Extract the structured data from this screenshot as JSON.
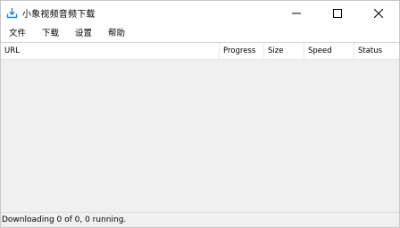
{
  "window": {
    "title": "小象视频音频下载",
    "icon": "download-icon",
    "accent_color": "#1e88e5"
  },
  "window_controls": {
    "minimize_icon": "minimize-icon",
    "maximize_icon": "maximize-icon",
    "close_icon": "close-icon"
  },
  "menu": {
    "items": [
      {
        "label": "文件"
      },
      {
        "label": "下载"
      },
      {
        "label": "设置"
      },
      {
        "label": "帮助"
      }
    ]
  },
  "table": {
    "columns": [
      {
        "label": "URL"
      },
      {
        "label": "Progress"
      },
      {
        "label": "Size"
      },
      {
        "label": "Speed"
      },
      {
        "label": "Status"
      }
    ],
    "rows": []
  },
  "statusbar": {
    "text": "Downloading 0 of 0, 0 running."
  }
}
